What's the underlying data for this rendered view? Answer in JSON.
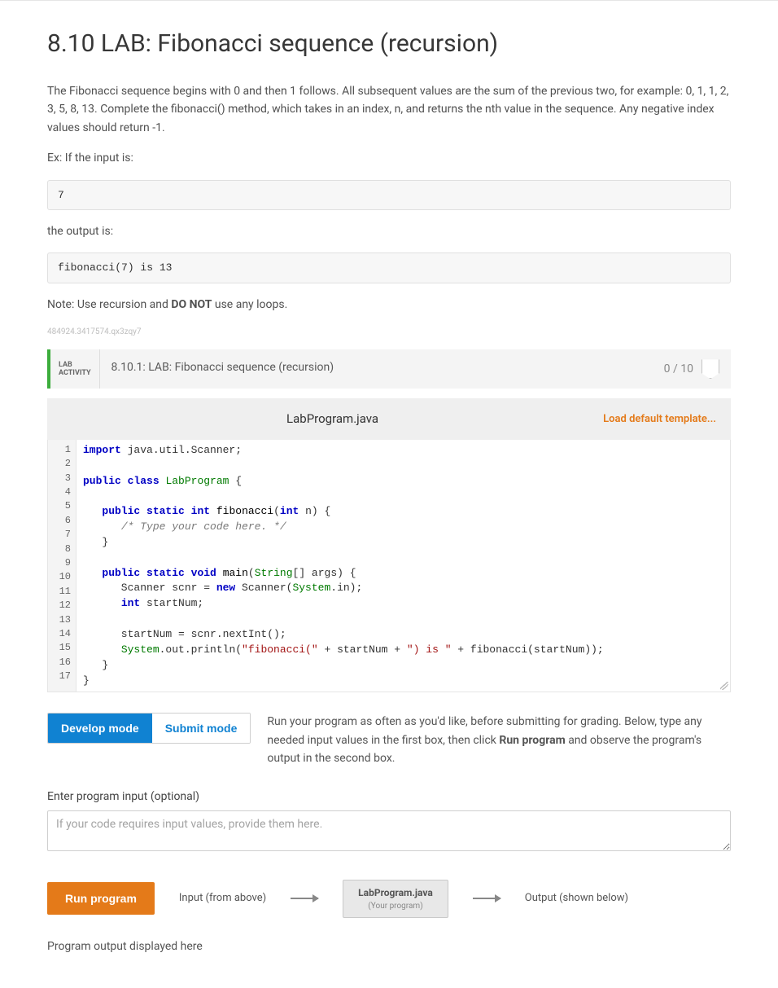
{
  "title": "8.10 LAB: Fibonacci sequence (recursion)",
  "description": "The Fibonacci sequence begins with 0 and then 1 follows. All subsequent values are the sum of the previous two, for example: 0, 1, 1, 2, 3, 5, 8, 13. Complete the fibonacci() method, which takes in an index, n, and returns the nth value in the sequence. Any negative index values should return -1.",
  "example_intro": "Ex: If the input is:",
  "example_input": "7",
  "example_output_label": "the output is:",
  "example_output": "fibonacci(7) is 13",
  "note_prefix": "Note: Use recursion and ",
  "note_bold": "DO NOT",
  "note_suffix": " use any loops.",
  "tiny_id": "484924.3417574.qx3zqy7",
  "lab": {
    "tag_line1": "LAB",
    "tag_line2": "ACTIVITY",
    "title": "8.10.1: LAB: Fibonacci sequence (recursion)",
    "score": "0 / 10"
  },
  "editor": {
    "filename": "LabProgram.java",
    "load_template": "Load default template...",
    "line_count": 17,
    "code_html": "<span class='kw'>import</span> java.util.Scanner;\n\n<span class='kw'>public</span> <span class='kw'>class</span> <span class='sh'>LabProgram</span> {\n\n   <span class='kw'>public</span> <span class='kw'>static</span> <span class='ty'>int</span> <span class='fn'>fibonacci</span>(<span class='ty'>int</span> n) {\n      <span class='cm'>/* Type your code here. */</span>\n   }\n\n   <span class='kw'>public</span> <span class='kw'>static</span> <span class='ty'>void</span> <span class='fn'>main</span>(<span class='sh'>String</span>[] args) {\n      Scanner scnr = <span class='kw'>new</span> Scanner(<span class='sh'>System</span>.in);\n      <span class='ty'>int</span> startNum;\n\n      startNum = scnr.nextInt();\n      <span class='sh'>System</span>.out.println(<span class='str'>\"fibonacci(\"</span> + startNum + <span class='str'>\") is \"</span> + fibonacci(startNum));\n   }\n}\n"
  },
  "modes": {
    "develop": "Develop mode",
    "submit": "Submit mode",
    "desc_pre": "Run your program as often as you'd like, before submitting for grading. Below, type any needed input values in the first box, then click ",
    "desc_bold": "Run program",
    "desc_post": " and observe the program's output in the second box."
  },
  "input": {
    "label": "Enter program input (optional)",
    "placeholder": "If your code requires input values, provide them here."
  },
  "run": {
    "button": "Run program",
    "input_lbl": "Input (from above)",
    "prog_file": "LabProgram.java",
    "prog_sub": "(Your program)",
    "output_lbl": "Output (shown below)"
  },
  "output_caption": "Program output displayed here"
}
